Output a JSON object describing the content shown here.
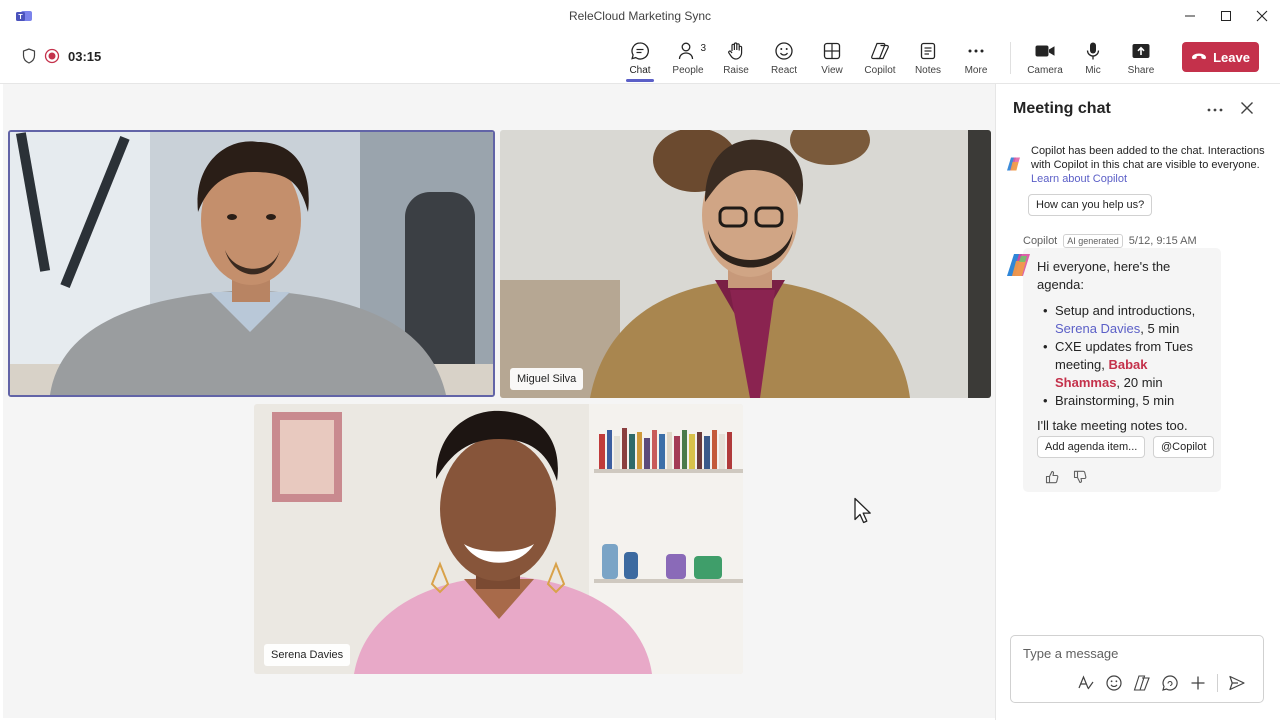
{
  "window": {
    "title": "ReleCloud Marketing Sync"
  },
  "status": {
    "timer": "03:15"
  },
  "toolbar": {
    "tools": [
      {
        "label": "Chat"
      },
      {
        "label": "People",
        "count": "3"
      },
      {
        "label": "Raise"
      },
      {
        "label": "React"
      },
      {
        "label": "View"
      },
      {
        "label": "Copilot"
      },
      {
        "label": "Notes"
      },
      {
        "label": "More"
      }
    ],
    "devices": [
      {
        "label": "Camera"
      },
      {
        "label": "Mic"
      },
      {
        "label": "Share"
      }
    ],
    "leave_label": "Leave"
  },
  "participants": {
    "miguel": "Miguel Silva",
    "serena": "Serena Davies"
  },
  "chat": {
    "title": "Meeting chat",
    "system_message": "Copilot has been added to the chat. Interactions with Copilot in this chat are visible to everyone.",
    "learn_link": "Learn about Copilot",
    "help_chip": "How can you help us?",
    "message": {
      "sender": "Copilot",
      "badge": "AI generated",
      "timestamp": "5/12, 9:15 AM",
      "intro": "Hi everyone, here's the agenda:",
      "item1_text": "Setup and introductions,",
      "item1_mention": "Serena Davies",
      "item1_suffix": ", 5 min",
      "item2_text": "CXE updates from Tues meeting,",
      "item2_mention": "Babak Shammas",
      "item2_suffix": ", 20 min",
      "item3_text": "Brainstorming, 5 min",
      "outro": "I'll take meeting notes too.",
      "action_agenda": "Add agenda item...",
      "action_copilot": "@Copilot"
    },
    "composer_placeholder": "Type a message"
  },
  "colors": {
    "accent": "#5b5fc7",
    "leave": "#c4314b",
    "mention": "#c4314b"
  }
}
